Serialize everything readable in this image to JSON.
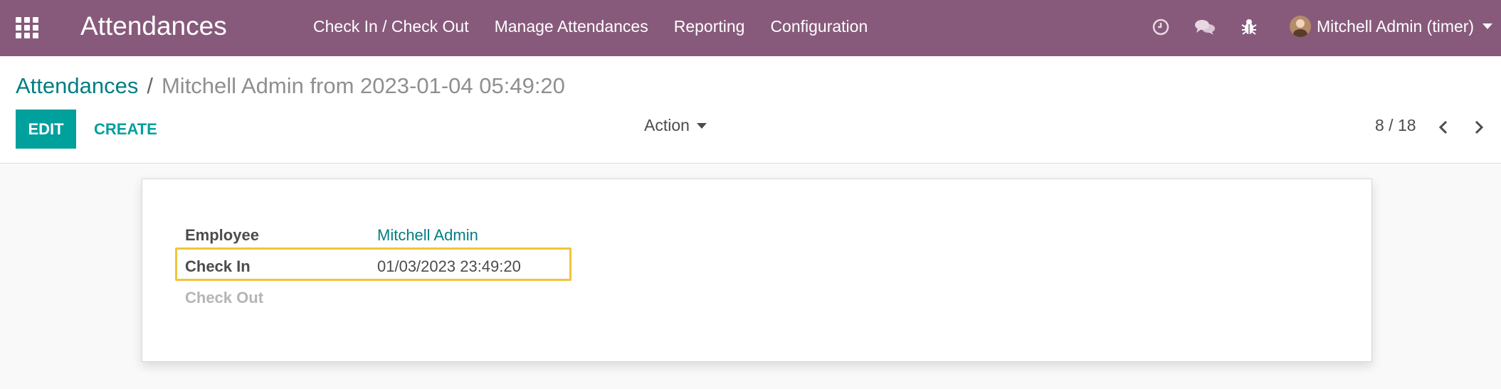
{
  "navbar": {
    "app_title": "Attendances",
    "menu": [
      {
        "label": "Check In / Check Out"
      },
      {
        "label": "Manage Attendances"
      },
      {
        "label": "Reporting"
      },
      {
        "label": "Configuration"
      }
    ],
    "icons": [
      "clock-icon",
      "chat-icon",
      "bug-icon"
    ],
    "user_name": "Mitchell Admin (timer)"
  },
  "breadcrumb": {
    "parent": "Attendances",
    "separator": "/",
    "current": "Mitchell Admin from 2023-01-04 05:49:20"
  },
  "toolbar": {
    "edit_label": "EDIT",
    "create_label": "CREATE",
    "action_label": "Action"
  },
  "pager": {
    "text": "8 / 18"
  },
  "form": {
    "employee_label": "Employee",
    "employee_value": "Mitchell Admin",
    "check_in_label": "Check In",
    "check_in_value": "01/03/2023 23:49:20",
    "check_out_label": "Check Out",
    "check_out_value": ""
  },
  "colors": {
    "navbar": "#875a7b",
    "primary": "#00a09d",
    "link": "#017e84",
    "highlight": "#f0c53a"
  }
}
